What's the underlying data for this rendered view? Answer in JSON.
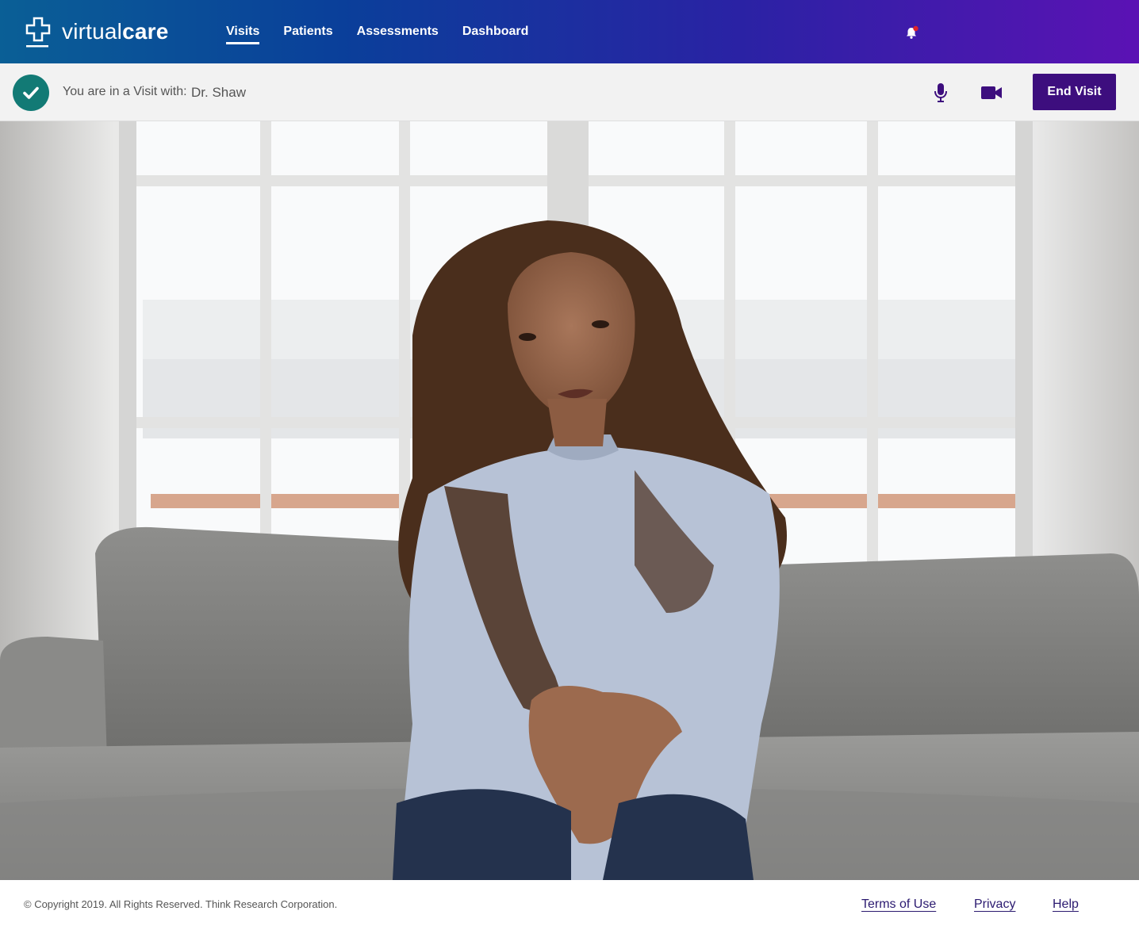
{
  "header": {
    "logo_light": "virtual",
    "logo_bold": "care",
    "nav": [
      {
        "label": "Visits",
        "active": true
      },
      {
        "label": "Patients",
        "active": false
      },
      {
        "label": "Assessments",
        "active": false
      },
      {
        "label": "Dashboard",
        "active": false
      }
    ],
    "notification_icon": "bell-icon",
    "notification_dot_color": "#e0232a"
  },
  "visit_bar": {
    "status_icon": "check-icon",
    "status_color": "#127a75",
    "label": "You are in a Visit with:",
    "doctor": "Dr. Shaw",
    "mic_icon": "microphone-icon",
    "camera_icon": "video-camera-icon",
    "end_button": "End Visit",
    "accent_color": "#3d0e7e"
  },
  "video": {
    "content": "patient-video-feed"
  },
  "footer": {
    "copyright": "© Copyright 2019. All Rights Reserved. Think Research Corporation.",
    "links": [
      "Terms of Use",
      "Privacy",
      "Help"
    ]
  }
}
